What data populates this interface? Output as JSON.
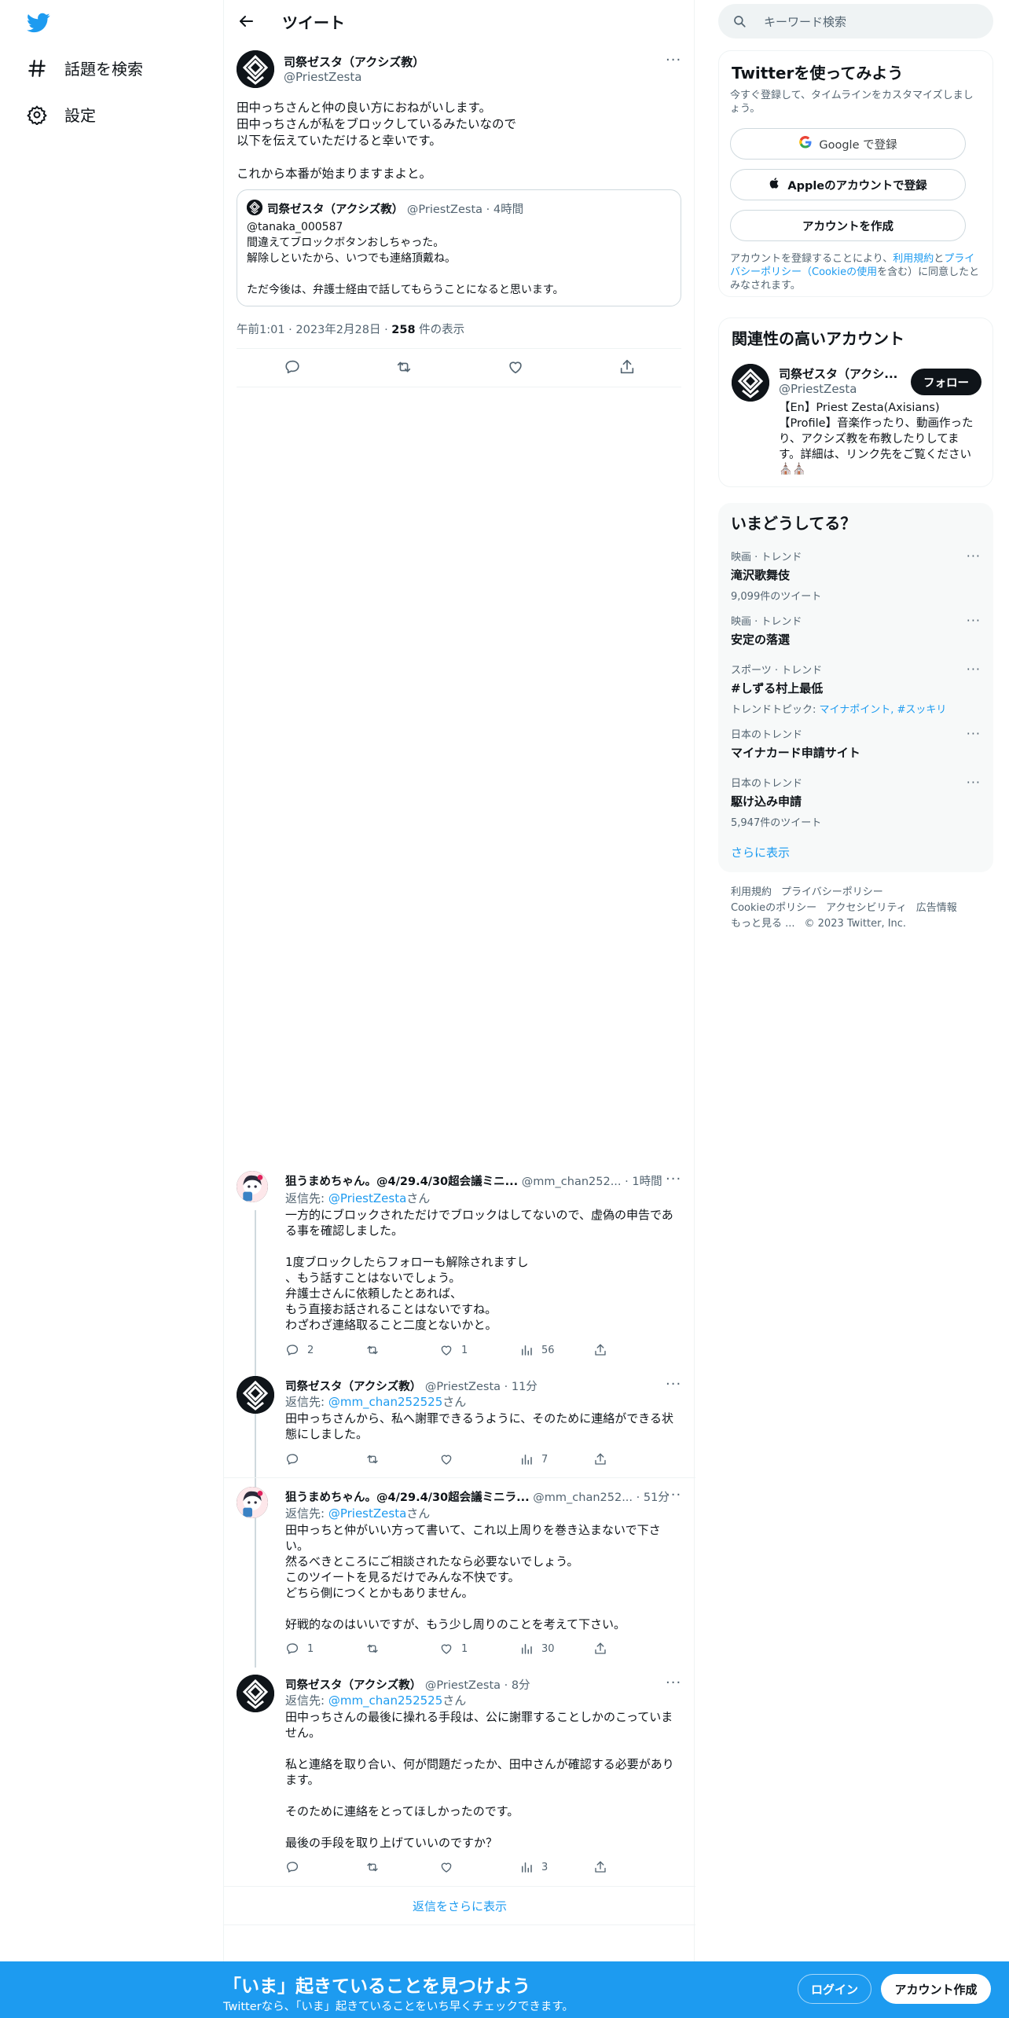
{
  "sidebar": {
    "items": [
      {
        "label": "話題を検索",
        "icon": "hashtag-icon"
      },
      {
        "label": "設定",
        "icon": "gear-icon"
      }
    ]
  },
  "header": {
    "title": "ツイート"
  },
  "main_tweet": {
    "name": "司祭ゼスタ（アクシズ教）",
    "handle": "@PriestZesta",
    "text": "田中っちさんと仲の良い方におねがいします。\n田中っちさんが私をブロックしているみたいなので\n以下を伝えていただけると幸いです。\n\nこれから本番が始まりますまよと。",
    "quote": {
      "name": "司祭ゼスタ（アクシズ教）",
      "handle": "@PriestZesta",
      "time": "· 4時間",
      "text": "@tanaka_000587\n間違えてブロックボタンおしちゃった。\n解除しといたから、いつでも連絡頂戴ね。\n\nただ今後は、弁護士経由で話してもらうことになると思います。"
    },
    "meta_time": "午前1:01 · 2023年2月28日 · ",
    "views_count": "258",
    "views_label": " 件の表示"
  },
  "replies": [
    {
      "name": "狙うまめちゃん。@4/29.4/30超会議ミニ...",
      "handle": "@mm_chan252...",
      "time": "· 1時間",
      "reply_prefix": "返信先: ",
      "reply_to": "@PriestZesta",
      "reply_suffix": "さん",
      "text": "一方的にブロックされただけでブロックはしてないので、虚偽の申告であ\nる事を確認しました。\n\n1度ブロックしたらフォローも解除されますし\n、もう話すことはないでしょう。\n弁護士さんに依頼したとあれば、\nもう直接お話されることはないですね。\nわざわざ連絡取ること二度とないかと。",
      "replies": "2",
      "retweets": "",
      "likes": "1",
      "views": "56"
    },
    {
      "name": "司祭ゼスタ（アクシズ教）",
      "handle": "@PriestZesta",
      "time": "· 11分",
      "reply_prefix": "返信先: ",
      "reply_to": "@mm_chan252525",
      "reply_suffix": "さん",
      "text": "田中っちさんから、私へ謝罪できるうように、そのために連絡ができる状\n態にしました。",
      "replies": "",
      "retweets": "",
      "likes": "",
      "views": "7"
    },
    {
      "name": "狙うまめちゃん。@4/29.4/30超会議ミニラ...",
      "handle": "@mm_chan252...",
      "time": "· 51分",
      "reply_prefix": "返信先: ",
      "reply_to": "@PriestZesta",
      "reply_suffix": "さん",
      "text": "田中っちと仲がいい方って書いて、これ以上周りを巻き込まないで下さ\nい。\n然るべきところにご相談されたなら必要ないでしょう。\nこのツイートを見るだけでみんな不快です。\nどちら側につくとかもありません。\n\n好戦的なのはいいですが、もう少し周りのことを考えて下さい。",
      "replies": "1",
      "retweets": "",
      "likes": "1",
      "views": "30"
    },
    {
      "name": "司祭ゼスタ（アクシズ教）",
      "handle": "@PriestZesta",
      "time": "· 8分",
      "reply_prefix": "返信先: ",
      "reply_to": "@mm_chan252525",
      "reply_suffix": "さん",
      "text": "田中っちさんの最後に操れる手段は、公に謝罪することしかのこっていま\nせん。\n\n私と連絡を取り合い、何が問題だったか、田中さんが確認する必要があり\nます。\n\nそのために連絡をとってほしかったのです。\n\n最後の手段を取り上げていいのですか？",
      "replies": "",
      "retweets": "",
      "likes": "",
      "views": "3"
    }
  ],
  "show_more_replies": "返信をさらに表示",
  "search": {
    "placeholder": "キーワード検索"
  },
  "signup_card": {
    "title": "Twitterを使ってみよう",
    "subtitle": "今すぐ登録して、タイムラインをカスタマイズしましょう。",
    "google_btn": "Google で登録",
    "apple_btn": "Appleのアカウントで登録",
    "create_btn": "アカウントを作成",
    "legal_1": "アカウントを登録することにより、",
    "legal_terms": "利用規約",
    "legal_2": "と",
    "legal_privacy": "プライバシーポリシー（Cookieの使用",
    "legal_3": "を含む）に同意したとみなされます。"
  },
  "related_card": {
    "title": "関連性の高いアカウント",
    "name": "司祭ゼスタ（アクシ...",
    "handle": "@PriestZesta",
    "follow_btn": "フォロー",
    "bio": "【En】Priest Zesta(Axisians)\n【Profile】音楽作ったり、動画作った\nり、アクシズ教を布教したりしてま\nす。詳細は、リンク先をご覧ください",
    "bio_emoji": "⛪⛪"
  },
  "trends_card": {
    "title": "いまどうしてる？",
    "items": [
      {
        "category": "映画 · トレンド",
        "title": "滝沢歌舞伎",
        "sub": "9,099件のツイート"
      },
      {
        "category": "映画 · トレンド",
        "title": "安定の落選",
        "sub": ""
      },
      {
        "category": "スポーツ · トレンド",
        "title": "#しずる村上最低",
        "sub_prefix": "トレンドトピック: ",
        "sub_link": "マイナポイント, #スッキリ"
      },
      {
        "category": "日本のトレンド",
        "title": "マイナカード申請サイト",
        "sub": ""
      },
      {
        "category": "日本のトレンド",
        "title": "駆け込み申請",
        "sub": "5,947件のツイート"
      }
    ],
    "show_more": "さらに表示"
  },
  "footer": {
    "links": [
      "利用規約",
      "プライバシーポリシー",
      "Cookieのポリシー",
      "アクセシビリティ",
      "広告情報",
      "もっと見る ...",
      "© 2023 Twitter, Inc."
    ]
  },
  "bottom_bar": {
    "title": "「いま」起きていることを見つけよう",
    "subtitle": "Twitterなら、「いま」起きていることをいち早くチェックできます。",
    "login": "ログイン",
    "signup": "アカウント作成"
  },
  "colors": {
    "accent": "#1d9bf0",
    "text": "#0f1419",
    "secondary": "#536471"
  }
}
